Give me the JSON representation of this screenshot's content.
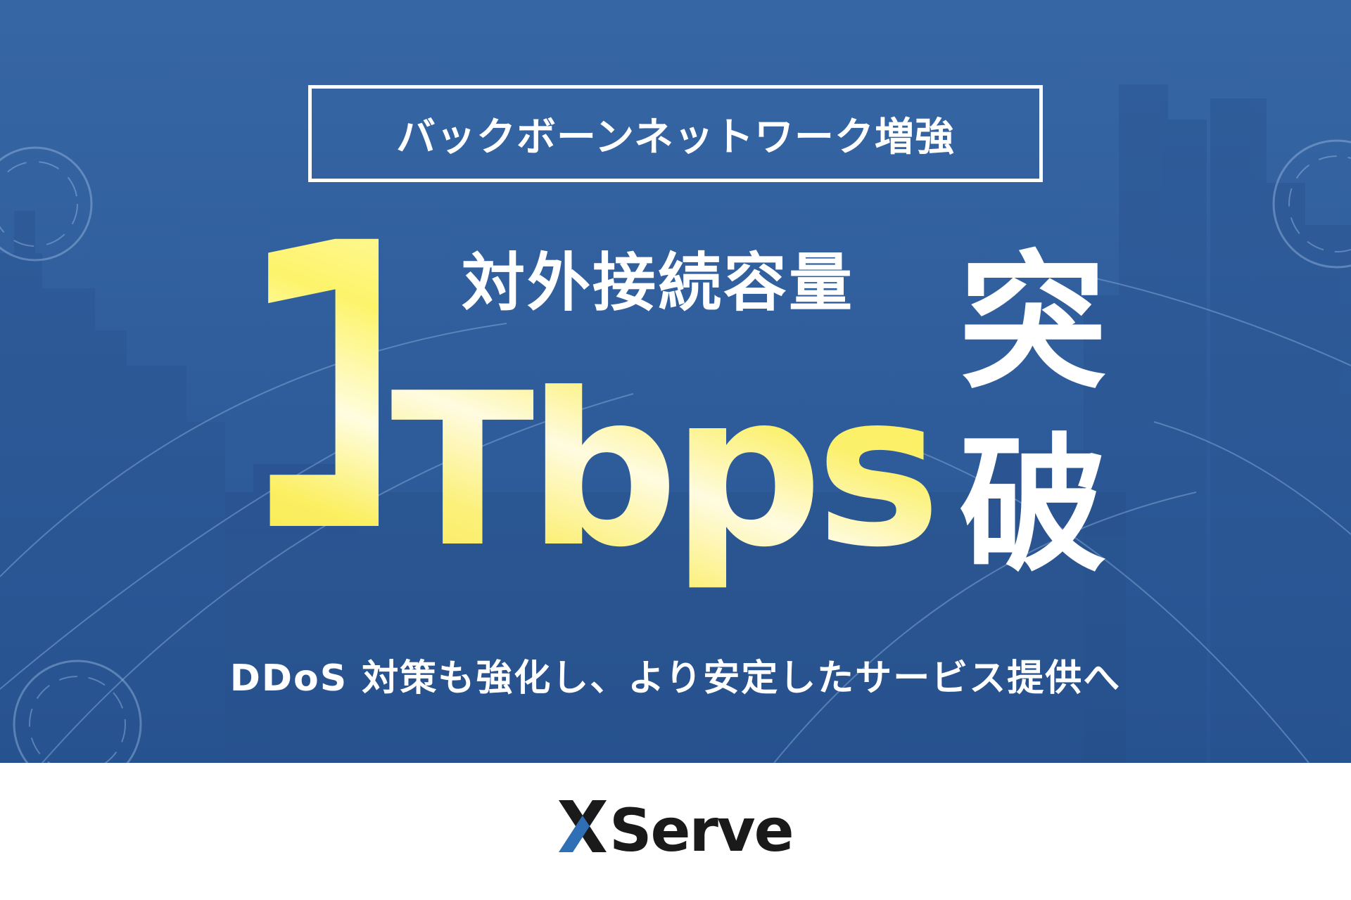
{
  "headline": "バックボーンネットワーク増強",
  "capacity_label": "対外接続容量",
  "big_number": "1",
  "unit": "Tbps",
  "breakthrough": [
    "突",
    "破"
  ],
  "subline": "DDoS 対策も強化し、より安定したサービス提供へ",
  "logo_text": "XServer",
  "colors": {
    "background_blue": "#2f5d9c",
    "highlight_yellow": "#fcef5a",
    "text_white": "#ffffff",
    "footer_white": "#ffffff",
    "logo_dark": "#1a1a1a",
    "logo_accent": "#2f6fb6"
  }
}
